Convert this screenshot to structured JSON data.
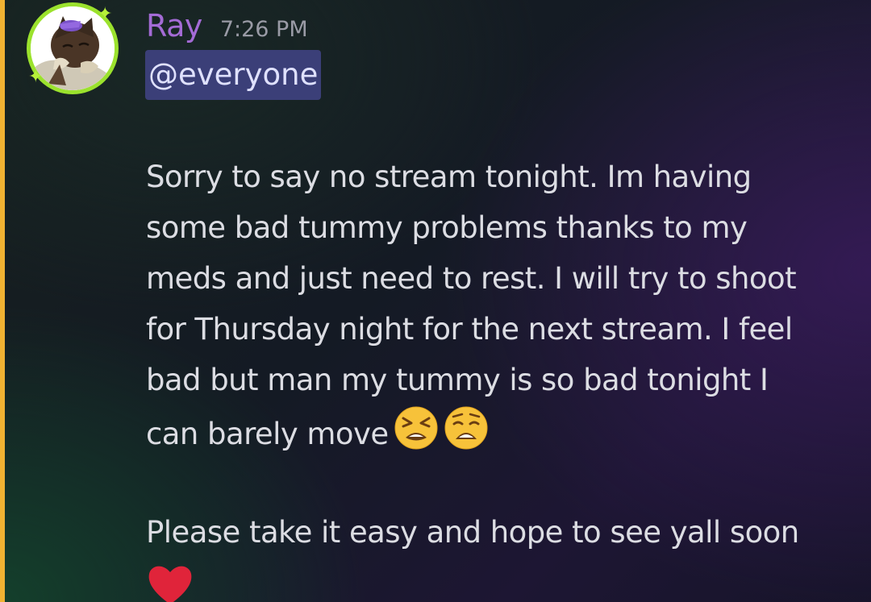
{
  "message": {
    "author": "Ray",
    "timestamp": "7:26 PM",
    "mention": "@everyone",
    "paragraph1_lines": [
      "Sorry to say no stream tonight. Im having",
      "some bad tummy problems thanks to my",
      "meds and just need to rest. I will try to shoot",
      "for Thursday night for the next stream. I feel",
      "bad but man my tummy is so bad tonight I",
      "can barely move"
    ],
    "paragraph1_emojis": [
      "tired-face-emoji",
      "weary-face-emoji"
    ],
    "paragraph2": "Please take it easy and hope to see yall soon",
    "paragraph2_emoji": "red-heart-emoji"
  },
  "colors": {
    "username": "#a46bd6",
    "mention_bg": "#3b3f78",
    "mention_bar": "#f0b232",
    "avatar_ring": "#9be22d",
    "heart": "#e0243a"
  }
}
